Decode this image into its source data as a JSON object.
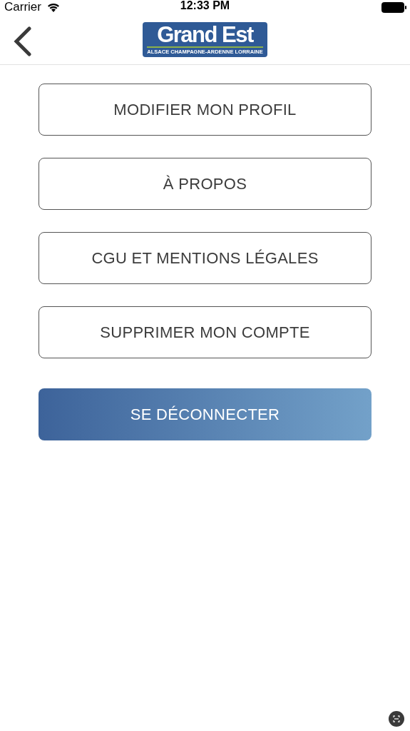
{
  "status_bar": {
    "carrier": "Carrier",
    "time": "12:33 PM"
  },
  "nav": {
    "logo": {
      "title": "Grand Est",
      "subtitle": "ALSACE CHAMPAGNE-ARDENNE LORRAINE"
    }
  },
  "buttons": [
    {
      "label": "MODIFIER MON PROFIL",
      "kind": "outline"
    },
    {
      "label": "À PROPOS",
      "kind": "outline"
    },
    {
      "label": "CGU ET MENTIONS LÉGALES",
      "kind": "outline"
    },
    {
      "label": "SUPPRIMER MON COMPTE",
      "kind": "outline"
    },
    {
      "label": "SE DÉCONNECTER",
      "kind": "filled"
    }
  ]
}
